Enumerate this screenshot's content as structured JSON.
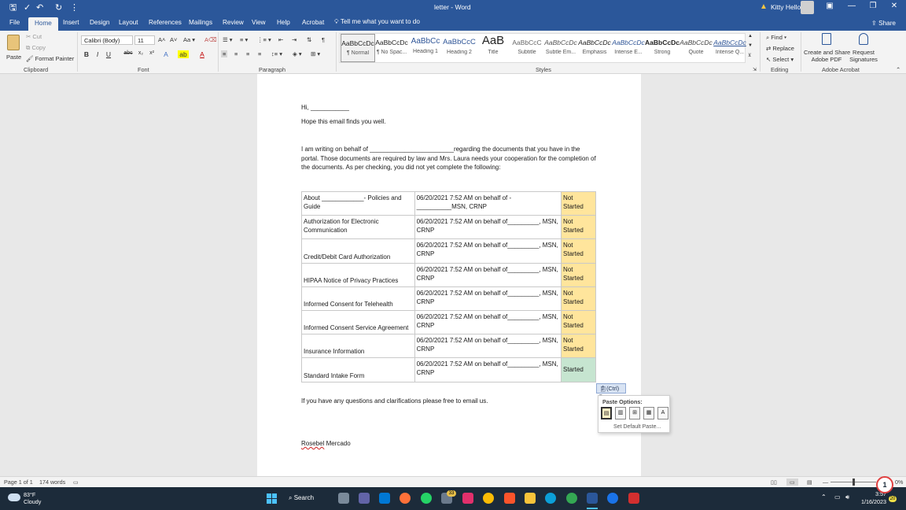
{
  "window": {
    "title": "letter  -  Word",
    "user_name": "Kitty Hello"
  },
  "tabs": [
    "File",
    "Home",
    "Insert",
    "Design",
    "Layout",
    "References",
    "Mailings",
    "Review",
    "View",
    "Help",
    "Acrobat"
  ],
  "tell_me": "Tell me what you want to do",
  "share_label": "Share",
  "ribbon": {
    "clipboard": {
      "paste": "Paste",
      "cut": "Cut",
      "copy": "Copy",
      "format_painter": "Format Painter",
      "group_label": "Clipboard"
    },
    "font": {
      "font_name": "Calibri (Body)",
      "font_size": "11",
      "group_label": "Font"
    },
    "paragraph_label": "Paragraph",
    "styles": {
      "group_label": "Styles",
      "items": [
        {
          "sample": "AaBbCcDc",
          "name": "¶ Normal"
        },
        {
          "sample": "AaBbCcDc",
          "name": "¶ No Spac..."
        },
        {
          "sample": "AaBbCc",
          "name": "Heading 1"
        },
        {
          "sample": "AaBbCcC",
          "name": "Heading 2"
        },
        {
          "sample": "AaB",
          "name": "Title"
        },
        {
          "sample": "AaBbCcC",
          "name": "Subtitle"
        },
        {
          "sample": "AaBbCcDc",
          "name": "Subtle Em..."
        },
        {
          "sample": "AaBbCcDc",
          "name": "Emphasis"
        },
        {
          "sample": "AaBbCcDc",
          "name": "Intense E..."
        },
        {
          "sample": "AaBbCcDc",
          "name": "Strong"
        },
        {
          "sample": "AaBbCcDc",
          "name": "Quote"
        },
        {
          "sample": "AaBbCcDc",
          "name": "Intense Q..."
        }
      ]
    },
    "editing": {
      "find": "Find",
      "replace": "Replace",
      "select": "Select",
      "group_label": "Editing"
    },
    "acrobat": {
      "create_share_line1": "Create and Share",
      "create_share_line2": "Adobe PDF",
      "request_line1": "Request",
      "request_line2": "Signatures",
      "group_label": "Adobe Acrobat"
    }
  },
  "document": {
    "greeting": "Hi, ___________",
    "line1": "Hope this email finds you well.",
    "para": " I am writing on behalf of ________________________regarding the documents that you have in the portal. Those documents are required by law and Mrs. Laura needs your cooperation for the completion of the documents.  As per checking, you did not yet complete the following:",
    "table": [
      {
        "task": "About ____________- Policies and Guide",
        "detail": "06/20/2021 7:52 AM on behalf of - __________MSN, CRNP",
        "status": "Not Started"
      },
      {
        "task": "Authorization for Electronic Communication",
        "detail": "06/20/2021 7:52 AM on behalf of_________, MSN, CRNP",
        "status": "Not Started"
      },
      {
        "task": "Credit/Debit Card Authorization",
        "detail": "06/20/2021 7:52 AM on behalf of_________, MSN, CRNP",
        "status": "Not Started"
      },
      {
        "task": "HIPAA Notice of Privacy Practices",
        "detail": "06/20/2021 7:52 AM on behalf of_________, MSN, CRNP",
        "status": "Not Started"
      },
      {
        "task": "Informed Consent for Telehealth",
        "detail": "06/20/2021 7:52 AM on behalf of_________, MSN, CRNP",
        "status": "Not Started"
      },
      {
        "task": "Informed Consent Service Agreement",
        "detail": "06/20/2021 7:52 AM on behalf of_________, MSN, CRNP",
        "status": "Not Started"
      },
      {
        "task": "Insurance Information",
        "detail": "06/20/2021 7:52 AM on behalf of_________, MSN, CRNP",
        "status": "Not Started"
      },
      {
        "task": "Standard Intake Form",
        "detail": "06/20/2021 7:52 AM on behalf of_________, MSN, CRNP",
        "status": "Started"
      }
    ],
    "closing": "If you have any questions and clarifications please free to email us.",
    "signature_first": "Rosebel",
    "signature_last": " Mercado"
  },
  "paste_options": {
    "ctrl_tag": "(Ctrl)",
    "title": "Paste Options:",
    "set_default": "Set Default Paste..."
  },
  "statusbar": {
    "page": "Page 1 of 1",
    "words": "174 words",
    "zoom": "0%"
  },
  "taskbar": {
    "temp": "83°F",
    "condition": "Cloudy",
    "search": "Search",
    "time": "3:57",
    "date": "1/16/2023",
    "badge_count": "33",
    "tray_badge": "20",
    "notification_count": "1"
  },
  "colors": {
    "word_blue": "#2b579a",
    "not_started": "#ffe59c",
    "started": "#c6e5d0"
  }
}
